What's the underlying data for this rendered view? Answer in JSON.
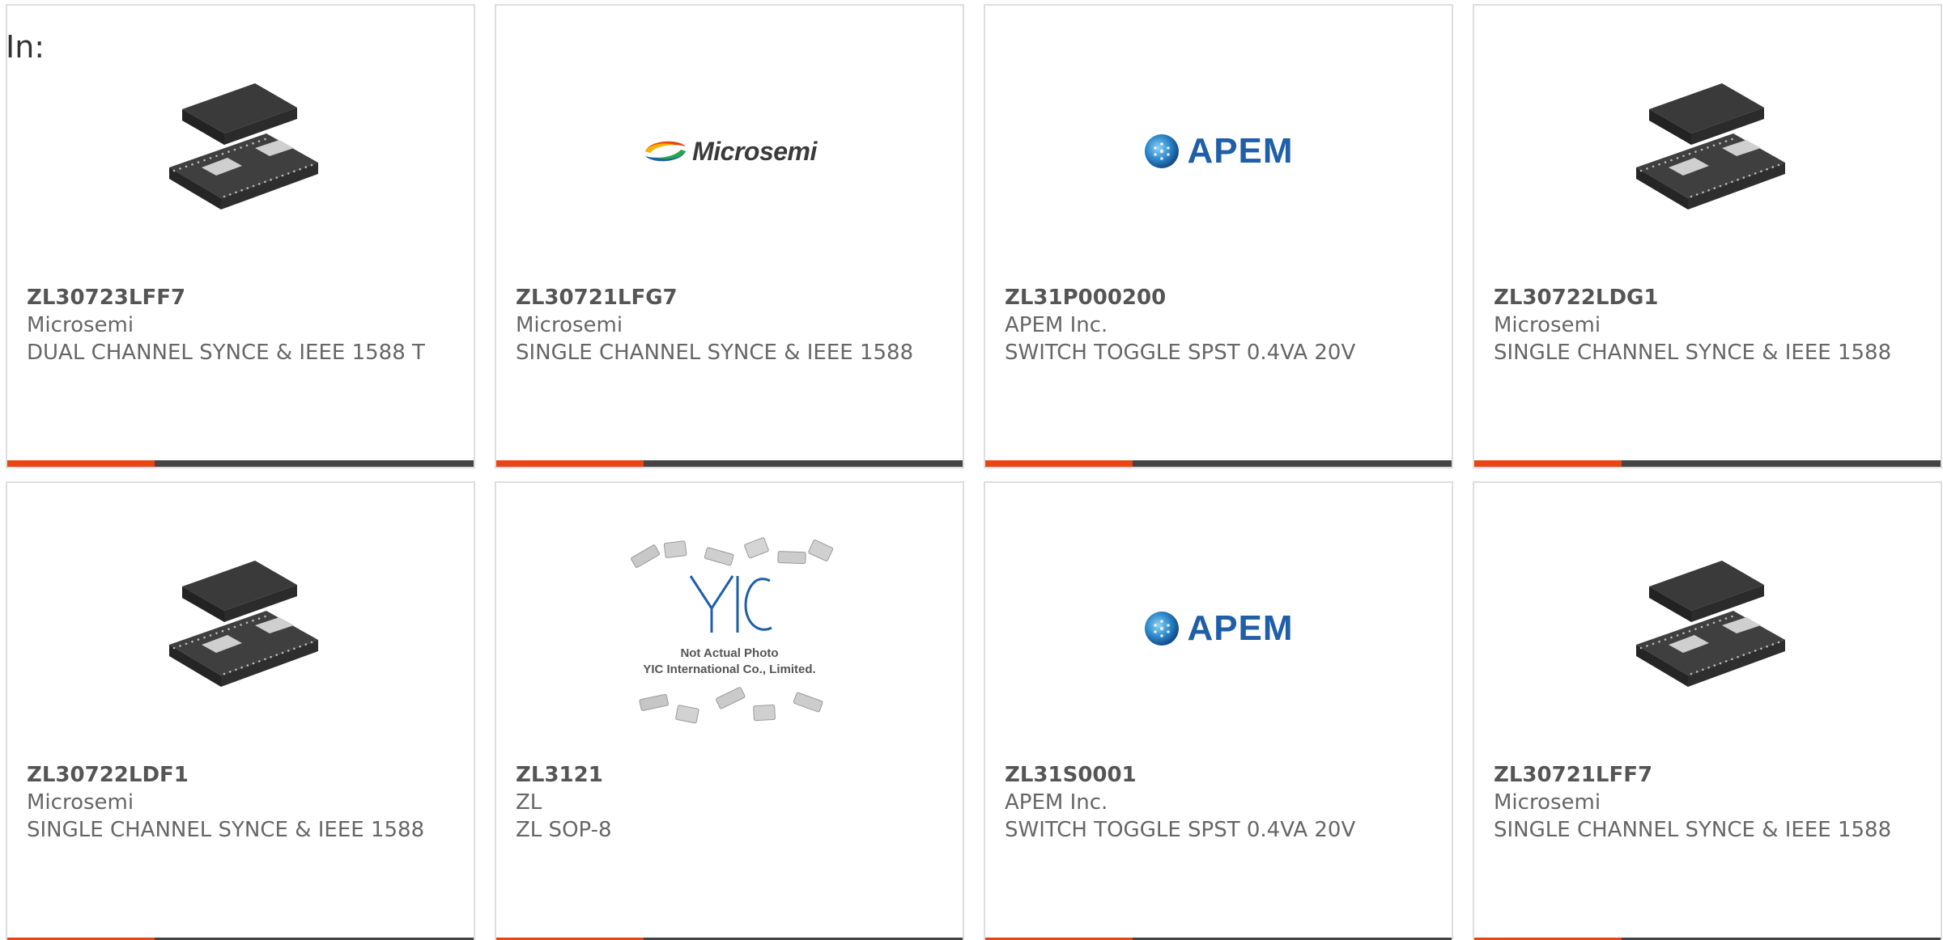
{
  "page": {
    "in_label": "In:"
  },
  "colors": {
    "accent": "#e84512",
    "bar_dark": "#444444",
    "apem_blue": "#1e5fa8"
  },
  "products": [
    {
      "part_number": "ZL30723LFF7",
      "manufacturer": "Microsemi",
      "description": "DUAL CHANNEL SYNCE & IEEE 1588 T",
      "image": "chip-package"
    },
    {
      "part_number": "ZL30721LFG7",
      "manufacturer": "Microsemi",
      "description": "SINGLE CHANNEL SYNCE & IEEE 1588",
      "image": "microsemi-logo",
      "logo_text": "Microsemi"
    },
    {
      "part_number": "ZL31P000200",
      "manufacturer": "APEM Inc.",
      "description": "SWITCH TOGGLE SPST 0.4VA 20V",
      "image": "apem-logo",
      "logo_text": "APEM"
    },
    {
      "part_number": "ZL30722LDG1",
      "manufacturer": "Microsemi",
      "description": "SINGLE CHANNEL SYNCE & IEEE 1588",
      "image": "chip-package"
    },
    {
      "part_number": "ZL30722LDF1",
      "manufacturer": "Microsemi",
      "description": "SINGLE CHANNEL SYNCE & IEEE 1588",
      "image": "chip-package"
    },
    {
      "part_number": "ZL3121",
      "manufacturer": "ZL",
      "description": "ZL SOP-8",
      "image": "placeholder-photo",
      "placeholder_lines": [
        "Not Actual Photo",
        "YIC International Co., Limited."
      ]
    },
    {
      "part_number": "ZL31S0001",
      "manufacturer": "APEM Inc.",
      "description": "SWITCH TOGGLE SPST 0.4VA 20V",
      "image": "apem-logo",
      "logo_text": "APEM"
    },
    {
      "part_number": "ZL30721LFF7",
      "manufacturer": "Microsemi",
      "description": "SINGLE CHANNEL SYNCE & IEEE 1588",
      "image": "chip-package"
    }
  ]
}
